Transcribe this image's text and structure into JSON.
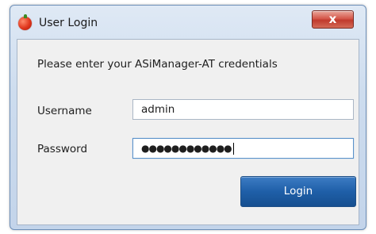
{
  "window": {
    "title": "User Login",
    "icon": "app-apple-icon",
    "close_label": "x"
  },
  "form": {
    "prompt": "Please enter your ASiManager-AT credentials",
    "username_label": "Username",
    "username_value": "admin",
    "password_label": "Password",
    "password_mask": "●●●●●●●●●●●●",
    "login_label": "Login"
  },
  "colors": {
    "accent": "#1f5fa8",
    "close": "#c03a2c"
  }
}
